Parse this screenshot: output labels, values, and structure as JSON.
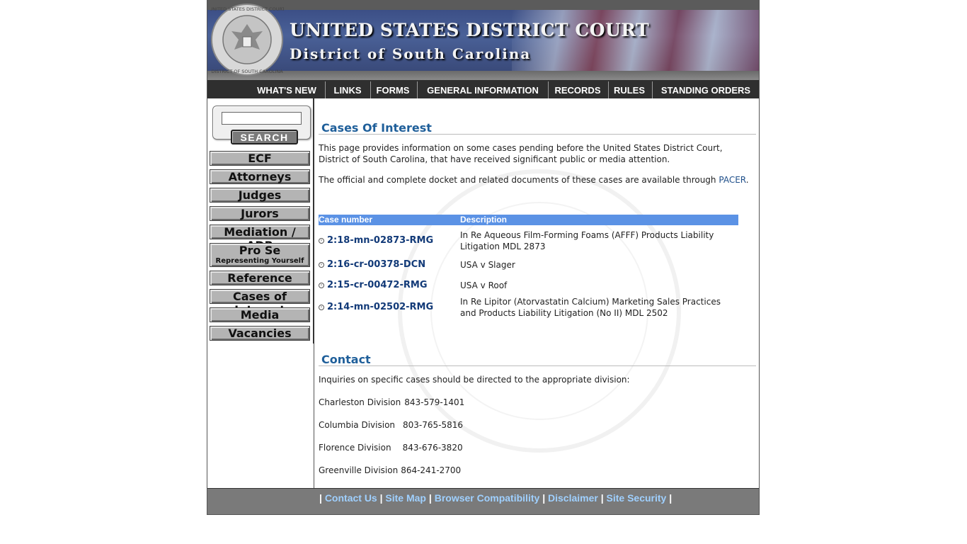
{
  "header": {
    "court_title": "UNITED STATES DISTRICT COURT",
    "district_title": "District of South Carolina",
    "seal_text": "UNITED STATES DISTRICT COURT · DISTRICT OF SOUTH CAROLINA"
  },
  "topnav": {
    "items": [
      "WHAT'S NEW",
      "LINKS",
      "FORMS",
      "GENERAL INFORMATION",
      "RECORDS",
      "RULES",
      "STANDING ORDERS"
    ]
  },
  "sidebar": {
    "search_value": "",
    "search_label": "SEARCH",
    "items": [
      {
        "label": "ECF",
        "sub": ""
      },
      {
        "label": "Attorneys",
        "sub": ""
      },
      {
        "label": "Judges",
        "sub": ""
      },
      {
        "label": "Jurors",
        "sub": ""
      },
      {
        "label": "Mediation / ADR",
        "sub": ""
      },
      {
        "label": "Pro Se",
        "sub": "Representing Yourself"
      },
      {
        "label": "Reference",
        "sub": ""
      },
      {
        "label": "Cases of Interest",
        "sub": ""
      },
      {
        "label": "Media",
        "sub": ""
      },
      {
        "label": "Vacancies",
        "sub": ""
      }
    ]
  },
  "main": {
    "heading": "Cases Of Interest",
    "intro": "This page provides information on some cases pending before the United States District Court, District of South Carolina, that have received significant public or media attention.",
    "docket_text": "The official and complete docket and related documents of these cases are available through ",
    "pacer_link": "PACER",
    "docket_end": ".",
    "table": {
      "headers": [
        "Case number",
        "Description"
      ],
      "rows": [
        {
          "case": "2:18-mn-02873-RMG",
          "description": "In Re Aqueous Film-Forming Foams (AFFF) Products Liability Litigation MDL 2873"
        },
        {
          "case": "2:16-cr-00378-DCN",
          "description": "USA v Slager"
        },
        {
          "case": "2:15-cr-00472-RMG",
          "description": "USA v Roof"
        },
        {
          "case": "2:14-mn-02502-RMG",
          "description": "In Re Lipitor (Atorvastatin Calcium) Marketing Sales Practices and Products Liability Litigation (No II) MDL 2502"
        }
      ]
    },
    "contact_heading": "Contact",
    "contact_intro": "Inquiries on specific cases should be directed to the appropriate division:",
    "divisions": [
      {
        "name": "Charleston Division",
        "phone": "843-579-1401"
      },
      {
        "name": "Columbia Division",
        "phone": "803-765-5816"
      },
      {
        "name": "Florence Division",
        "phone": "843-676-3820"
      },
      {
        "name": "Greenville Division",
        "phone": "864-241-2700"
      }
    ]
  },
  "footer": {
    "links": [
      "Contact Us",
      "Site Map",
      "Browser Compatibility",
      "Disclaimer",
      "Site Security"
    ],
    "separator": "|"
  }
}
